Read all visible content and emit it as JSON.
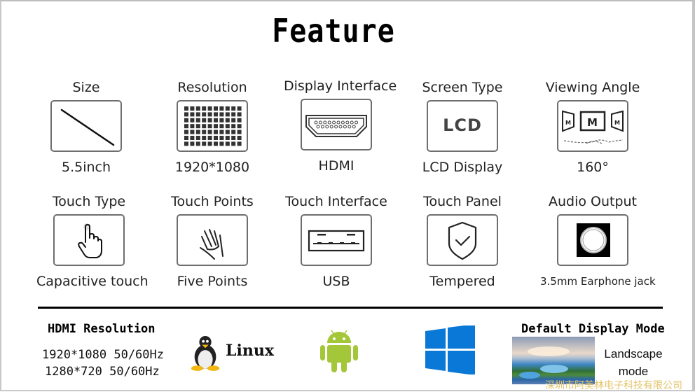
{
  "title": "Feature",
  "features_row1": [
    {
      "label": "Size",
      "value": "5.5inch",
      "icon": "diagonal-line-icon"
    },
    {
      "label": "Resolution",
      "value": "1920*1080",
      "icon": "pixel-grid-icon"
    },
    {
      "label": "Display  Interface",
      "value": "HDMI",
      "icon": "hdmi-port-icon"
    },
    {
      "label": "Screen Type",
      "value": "LCD Display",
      "icon": "lcd-icon",
      "icon_text": "LCD"
    },
    {
      "label": "Viewing Angle",
      "value": "160°",
      "icon": "viewing-angle-icon",
      "icon_text": "M"
    }
  ],
  "features_row2": [
    {
      "label": "Touch Type",
      "value": "Capacitive touch",
      "icon": "pointing-hand-icon"
    },
    {
      "label": "Touch Points",
      "value": "Five Points",
      "icon": "open-hand-icon"
    },
    {
      "label": "Touch Interface",
      "value": "USB",
      "icon": "usb-port-icon"
    },
    {
      "label": "Touch Panel",
      "value": "Tempered",
      "icon": "shield-check-icon"
    },
    {
      "label": "Audio Output",
      "value": "3.5mm Earphone jack",
      "icon": "audio-jack-icon"
    }
  ],
  "hdmi_resolution": {
    "title": "HDMI Resolution",
    "lines": [
      "1920*1080 50/60Hz",
      "1280*720 50/60Hz"
    ]
  },
  "os_support": [
    {
      "name": "Linux",
      "icon": "linux-tux-icon"
    },
    {
      "name": "Android",
      "icon": "android-icon",
      "color": "#a4c639"
    },
    {
      "name": "Windows",
      "icon": "windows-icon",
      "color": "#0a78d7"
    }
  ],
  "default_display_mode": {
    "title": "Default Display Mode",
    "value_line1": "Landscape",
    "value_line2": "mode"
  },
  "watermark": "深圳市阿美林电子科技有限公司"
}
